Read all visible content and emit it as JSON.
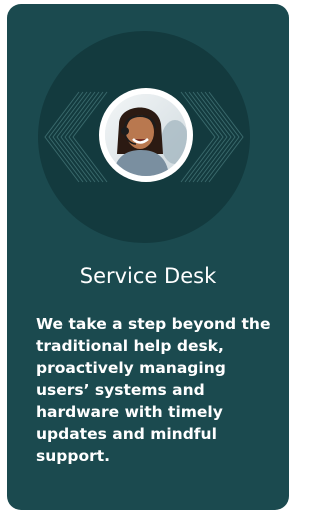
{
  "service": {
    "title": "Service Desk",
    "description": "We take a step beyond the traditional help desk, proactively managing users’ systems and hardware with timely updates and mindful support."
  },
  "colors": {
    "card_background": "#1b4a4f",
    "emblem_dark": "#133a3e",
    "chevron_line": "#3e6e70",
    "text": "#ffffff"
  },
  "image": {
    "icon": "support-agent-photo"
  }
}
